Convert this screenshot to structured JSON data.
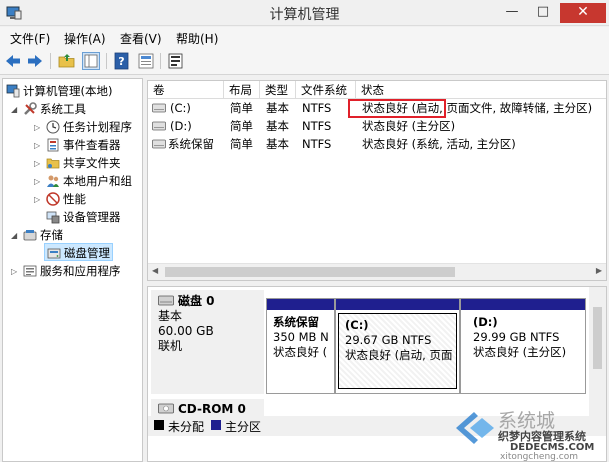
{
  "window": {
    "title": "计算机管理",
    "min_glyph": "—",
    "max_glyph": "□",
    "close_glyph": "✕"
  },
  "menu": [
    {
      "label": "文件(F)"
    },
    {
      "label": "操作(A)"
    },
    {
      "label": "查看(V)"
    },
    {
      "label": "帮助(H)"
    }
  ],
  "toolbar": {
    "icons": [
      "back-arrow-icon",
      "forward-arrow-icon",
      "up-folder-icon",
      "show-hide-tree-icon",
      "help-icon",
      "properties-icon",
      "export-icon"
    ]
  },
  "tree": {
    "root": "计算机管理(本地)",
    "system_tools": "系统工具",
    "task_scheduler": "任务计划程序",
    "event_viewer": "事件查看器",
    "shared_folders": "共享文件夹",
    "local_users": "本地用户和组",
    "performance": "性能",
    "device_manager": "设备管理器",
    "storage": "存储",
    "disk_management": "磁盘管理",
    "services_apps": "服务和应用程序"
  },
  "volume_list": {
    "columns": [
      "卷",
      "布局",
      "类型",
      "文件系统",
      "状态"
    ],
    "rows": [
      {
        "volume": "(C:)",
        "layout": "简单",
        "type": "基本",
        "fs": "NTFS",
        "status": "状态良好 (启动, 页面文件, 故障转储, 主分区)"
      },
      {
        "volume": "(D:)",
        "layout": "简单",
        "type": "基本",
        "fs": "NTFS",
        "status": "状态良好 (主分区)"
      },
      {
        "volume": "系统保留",
        "layout": "简单",
        "type": "基本",
        "fs": "NTFS",
        "status": "状态良好 (系统, 活动, 主分区)"
      }
    ]
  },
  "disks": {
    "disk0": {
      "name": "磁盘 0",
      "type": "基本",
      "size": "60.00 GB",
      "state": "联机",
      "partitions": [
        {
          "name": "系统保留",
          "size": "350 MB N",
          "status": "状态良好 ("
        },
        {
          "name": "(C:)",
          "size": "29.67 GB NTFS",
          "status": "状态良好 (启动, 页面"
        },
        {
          "name": "(D:)",
          "size": "29.99 GB NTFS",
          "status": "状态良好 (主分区)"
        }
      ]
    },
    "cdrom": {
      "name": "CD-ROM 0"
    }
  },
  "legend": {
    "unallocated": "未分配",
    "primary": "主分区",
    "unallocated_color": "#000000",
    "primary_color": "#1f1f8f"
  },
  "watermark": {
    "brand": "系统城",
    "line1": "织梦内容管理系统",
    "line2": "DEDECMS.COM",
    "line3": "xitongcheng.com"
  },
  "colors": {
    "partition_bar": "#1f1f8f",
    "highlight_border": "#e0202a",
    "close_button": "#c7372f",
    "selection": "#cce8ff"
  }
}
